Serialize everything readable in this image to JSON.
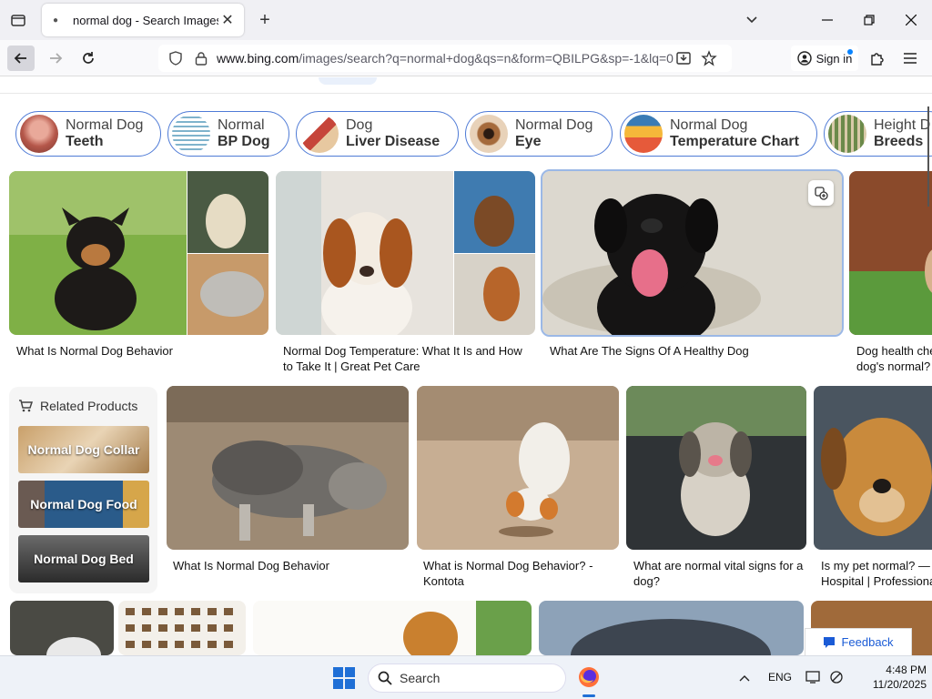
{
  "browser": {
    "tab_title": "normal dog - Search Images",
    "url_domain": "www.bing.com",
    "url_path": "/images/search?q=normal+dog&qs=n&form=QBILPG&sp=-1&lq=0",
    "sign_in_label": "Sign in"
  },
  "pills": [
    {
      "line1": "Normal Dog",
      "line2": "Teeth"
    },
    {
      "line1": "Normal",
      "line2": "BP Dog"
    },
    {
      "line1": "Dog",
      "line2": "Liver Disease"
    },
    {
      "line1": "Normal Dog",
      "line2": "Eye"
    },
    {
      "line1": "Normal Dog",
      "line2": "Temperature Chart"
    },
    {
      "line1": "Height D",
      "line2": "Breeds"
    }
  ],
  "results_row1": [
    {
      "caption": "What Is Normal Dog Behavior"
    },
    {
      "caption": "Normal Dog Temperature: What It Is and How to Take It | Great Pet Care"
    },
    {
      "caption": "What Are The Signs Of A Healthy Dog"
    },
    {
      "caption": "Dog health che... dog's normal?"
    }
  ],
  "related": {
    "title": "Related Products",
    "items": [
      "Normal Dog Collar",
      "Normal Dog Food",
      "Normal Dog Bed"
    ]
  },
  "results_row2": [
    {
      "caption": "What Is Normal Dog Behavior"
    },
    {
      "caption": "What is Normal Dog Behavior? - Kontota"
    },
    {
      "caption": "What are normal vital signs for a dog?"
    },
    {
      "caption": "Is my pet normal? — Hospital | Professiona"
    }
  ],
  "feedback_label": "Feedback",
  "taskbar": {
    "search_label": "Search",
    "language": "ENG",
    "time": "4:48 PM",
    "date": "11/20/2025"
  },
  "colors": {
    "accent_blue": "#4f7bd6",
    "windows_blue": "#1f6fd6"
  }
}
